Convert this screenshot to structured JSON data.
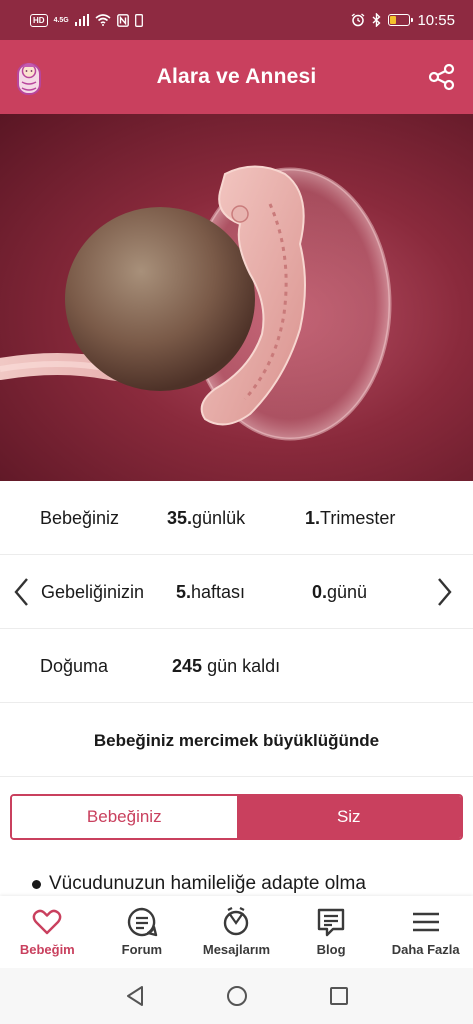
{
  "status_bar": {
    "hd_badge": "HD",
    "network": "4.5G",
    "time": "10:55",
    "battery_level": 0.3,
    "icons": [
      "signal-icon",
      "wifi-icon",
      "nfc-icon",
      "sim-icon",
      "alarm-icon",
      "bluetooth-icon",
      "battery-icon"
    ]
  },
  "app_bar": {
    "title": "Alara ve Annesi",
    "logo_icon": "baby-icon",
    "share_icon": "share-icon"
  },
  "hero": {
    "image": "embryo-illustration"
  },
  "baby_row": {
    "label": "Bebeğiniz",
    "age_value": "35.",
    "age_unit": "günlük",
    "trimester_value": "1.",
    "trimester_unit": "Trimester"
  },
  "pregnancy_row": {
    "label": "Gebeliğinizin",
    "week_value": "5.",
    "week_unit": "haftası",
    "day_value": "0.",
    "day_unit": "günü",
    "prev_icon": "chevron-left-icon",
    "next_icon": "chevron-right-icon"
  },
  "birth_row": {
    "label": "Doğuma",
    "days_value": "245",
    "days_unit": "gün kaldı"
  },
  "size_text": "Bebeğiniz mercimek büyüklüğünde",
  "tabs": {
    "baby": "Bebeğiniz",
    "you": "Siz",
    "selected": "you"
  },
  "content": {
    "bullet_text": "Vücudunuzun hamileliğe adapte olma"
  },
  "bottom_nav": [
    {
      "label": "Bebeğim",
      "icon": "heart-icon",
      "active": true
    },
    {
      "label": "Forum",
      "icon": "forum-icon",
      "active": false
    },
    {
      "label": "Mesajlarım",
      "icon": "messages-icon",
      "active": false
    },
    {
      "label": "Blog",
      "icon": "blog-icon",
      "active": false
    },
    {
      "label": "Daha Fazla",
      "icon": "menu-icon",
      "active": false
    }
  ],
  "colors": {
    "accent": "#c9405e",
    "status_bar": "#8e2a41",
    "text": "#1a1a1a"
  }
}
